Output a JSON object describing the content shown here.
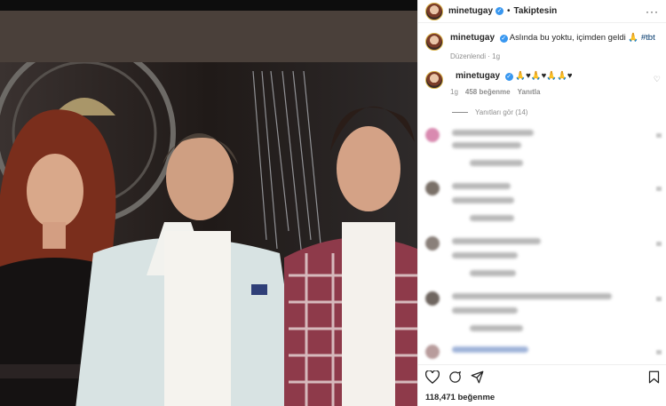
{
  "post": {
    "username": "minetugay",
    "follow_label": "Takiptesin",
    "dot": "•",
    "caption_text": "Aslında bu yoktu, içimden geldi 🙏",
    "hashtag": "#tbt",
    "caption_meta": "Düzenlendi · 1g",
    "comment_user": "minetugay",
    "comment_text": "🙏♥🙏♥🙏🙏♥",
    "comment_time": "1g",
    "comment_likes": "458 beğenme",
    "comment_reply": "Yanıtla",
    "view_replies": "Yanıtları gör (14)",
    "likes_count": "118,471",
    "likes_label": "beğenme",
    "verified_mark": "✓",
    "more_glyph": "···",
    "heart_glyph": "♡"
  },
  "colors": {
    "link": "#00376b",
    "verified": "#3897f0",
    "muted": "#8e8e8e"
  },
  "icons": [
    "heart-icon",
    "comment-icon",
    "share-icon",
    "bookmark-icon",
    "more-icon",
    "verified-icon"
  ]
}
